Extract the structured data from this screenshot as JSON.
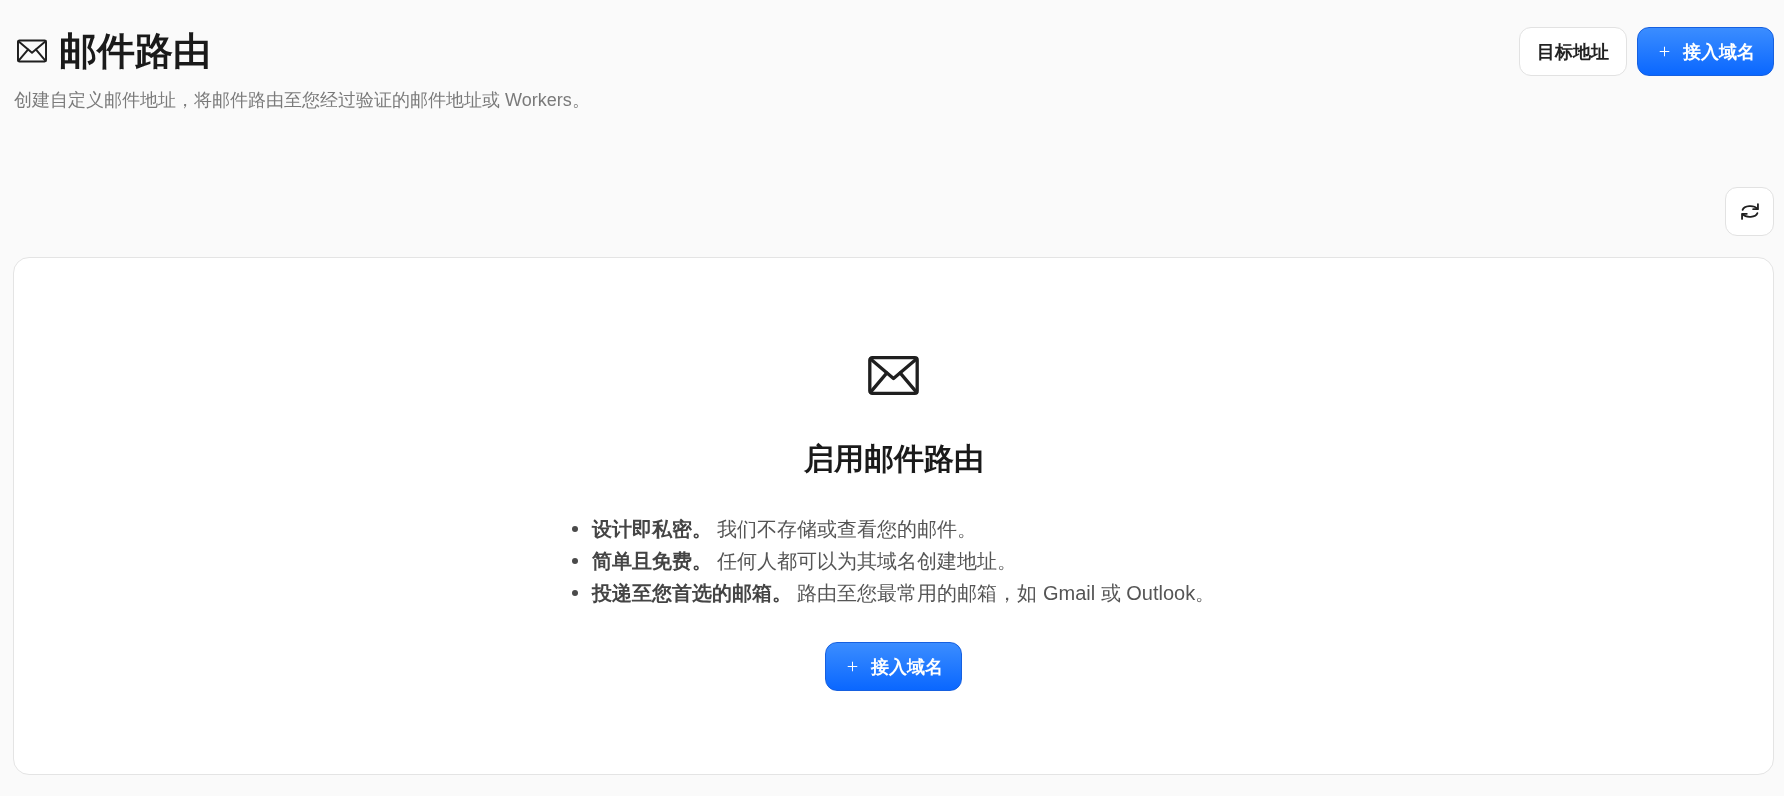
{
  "header": {
    "title": "邮件路由",
    "subtitle": "创建自定义邮件地址，将邮件路由至您经过验证的邮件地址或 Workers。",
    "actions": [
      {
        "kind": "secondary",
        "label": "目标地址"
      },
      {
        "kind": "primary",
        "label": "接入域名"
      }
    ]
  },
  "empty_state": {
    "title": "启用邮件路由",
    "features": [
      "**设计即私密。** 我们不存储或查看您的邮件。",
      "**简单且免费。** 任何人都可以为其域名创建地址。",
      "**投递至您首选的邮箱。** 路由至您最常用的邮箱，如 Gmail 或 Outlook。"
    ],
    "action": {
      "kind": "primary",
      "label": "接入域名"
    }
  }
}
